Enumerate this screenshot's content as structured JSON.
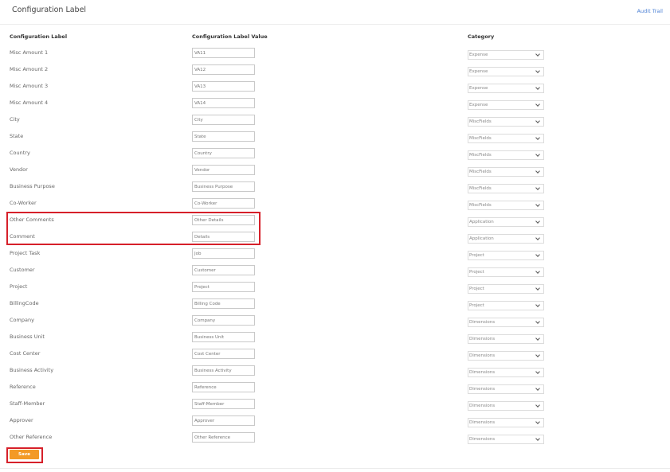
{
  "header": {
    "title": "Configuration Label",
    "audit_trail": "Audit Trail"
  },
  "columns": {
    "label": "Configuration Label",
    "value": "Configuration Label Value",
    "category": "Category"
  },
  "rows": [
    {
      "label": "Misc Amount 1",
      "value": "VA11",
      "category": "Expense"
    },
    {
      "label": "Misc Amount 2",
      "value": "VA12",
      "category": "Expense"
    },
    {
      "label": "Misc Amount 3",
      "value": "VA13",
      "category": "Expense"
    },
    {
      "label": "Misc Amount 4",
      "value": "VA14",
      "category": "Expense"
    },
    {
      "label": "City",
      "value": "City",
      "category": "MiscFields"
    },
    {
      "label": "State",
      "value": "State",
      "category": "MiscFields"
    },
    {
      "label": "Country",
      "value": "Country",
      "category": "MiscFields"
    },
    {
      "label": "Vendor",
      "value": "Vendor",
      "category": "MiscFields"
    },
    {
      "label": "Business Purpose",
      "value": "Business Purpose",
      "category": "MiscFields"
    },
    {
      "label": "Co-Worker",
      "value": "Co-Worker",
      "category": "MiscFields"
    },
    {
      "label": "Other Comments",
      "value": "Other Details",
      "category": "Application"
    },
    {
      "label": "Comment",
      "value": "Details",
      "category": "Application"
    },
    {
      "label": "Project Task",
      "value": "Job",
      "category": "Project"
    },
    {
      "label": "Customer",
      "value": "Customer",
      "category": "Project"
    },
    {
      "label": "Project",
      "value": "Project",
      "category": "Project"
    },
    {
      "label": "BillingCode",
      "value": "Billing Code",
      "category": "Project"
    },
    {
      "label": "Company",
      "value": "Company",
      "category": "Dimensions"
    },
    {
      "label": "Business Unit",
      "value": "Business Unit",
      "category": "Dimensions"
    },
    {
      "label": "Cost Center",
      "value": "Cost Center",
      "category": "Dimensions"
    },
    {
      "label": "Business Activity",
      "value": "Business Activity",
      "category": "Dimensions"
    },
    {
      "label": "Reference",
      "value": "Reference",
      "category": "Dimensions"
    },
    {
      "label": "Staff-Member",
      "value": "Staff-Member",
      "category": "Dimensions"
    },
    {
      "label": "Approver",
      "value": "Approver",
      "category": "Dimensions"
    },
    {
      "label": "Other Reference",
      "value": "Other Reference",
      "category": "Dimensions"
    }
  ],
  "actions": {
    "save": "Save"
  },
  "colors": {
    "accent": "#f39a26",
    "highlight": "#d6202a",
    "link": "#4a7fd4"
  }
}
